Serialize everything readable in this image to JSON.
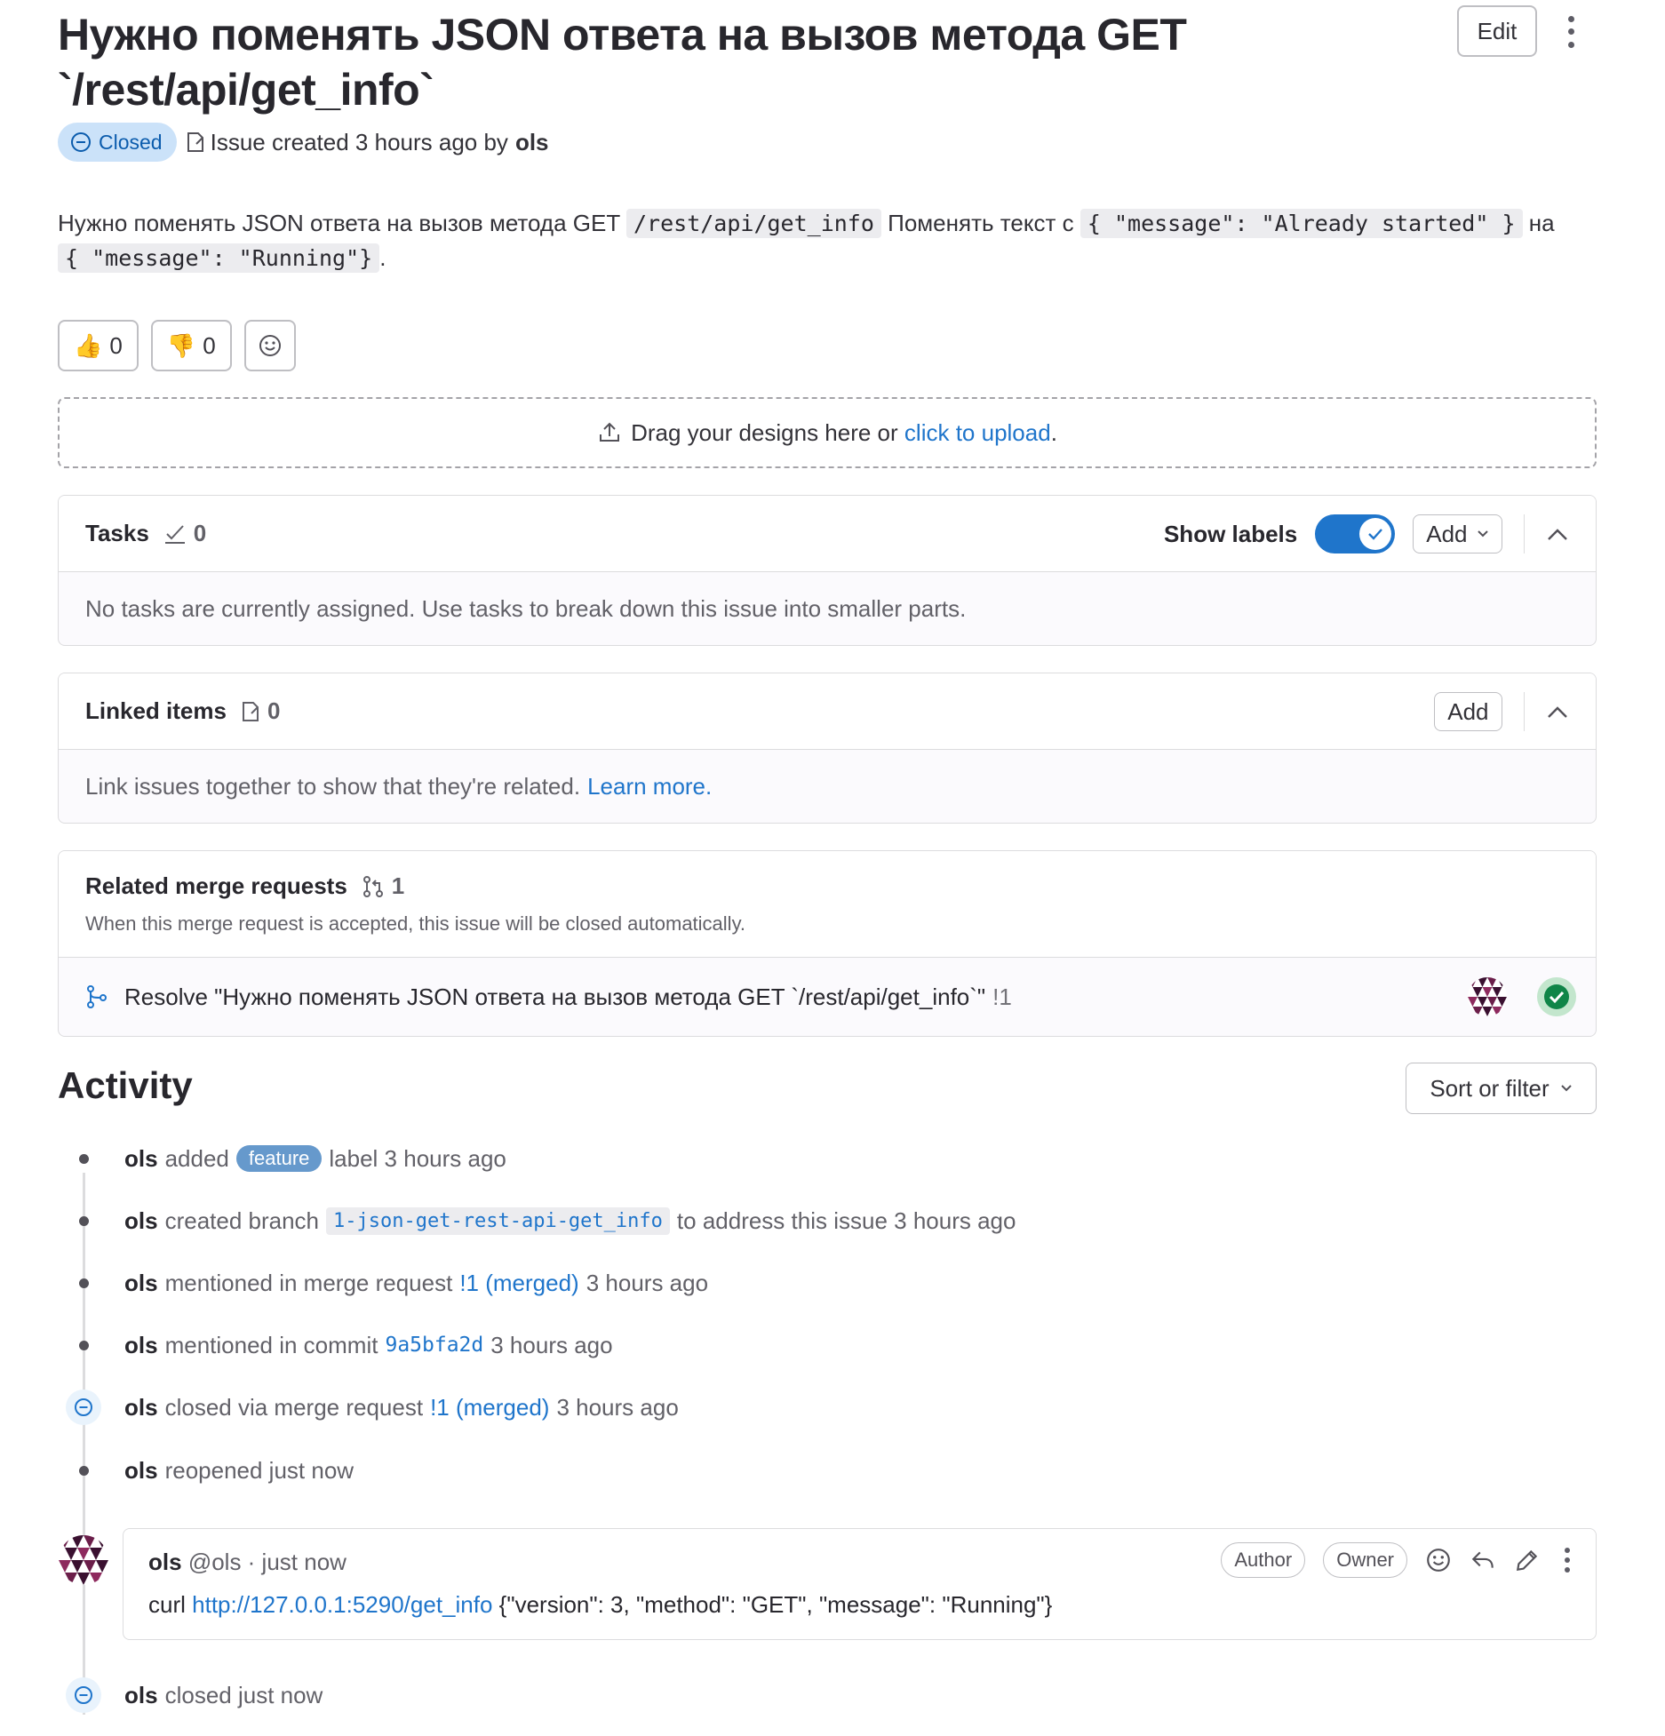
{
  "issue": {
    "title": "Нужно поменять JSON ответа на вызов метода GET `/rest/api/get_info`",
    "status": "Closed",
    "created_text": "Issue created 3 hours ago by",
    "author": "ols",
    "edit_label": "Edit"
  },
  "description": {
    "part1": "Нужно поменять JSON ответа на вызов метода GET",
    "code1": "/rest/api/get_info",
    "part2": "Поменять текст с",
    "code2": "{ \"message\": \"Already started\" }",
    "part3": "на",
    "code3": "{ \"message\": \"Running\"}",
    "part4": "."
  },
  "reactions": {
    "thumbs_up_emoji": "👍",
    "thumbs_up_count": "0",
    "thumbs_down_emoji": "👎",
    "thumbs_down_count": "0"
  },
  "designs": {
    "text": "Drag your designs here or",
    "link": "click to upload",
    "suffix": "."
  },
  "tasks": {
    "title": "Tasks",
    "count": "0",
    "show_labels": "Show labels",
    "add_label": "Add",
    "empty_text": "No tasks are currently assigned. Use tasks to break down this issue into smaller parts."
  },
  "linked": {
    "title": "Linked items",
    "count": "0",
    "add_label": "Add",
    "empty_text": "Link issues together to show that they're related.",
    "learn_more": "Learn more."
  },
  "related_mrs": {
    "title": "Related merge requests",
    "count": "1",
    "subtitle": "When this merge request is accepted, this issue will be closed automatically.",
    "items": [
      {
        "title": "Resolve \"Нужно поменять JSON ответа на вызов метода GET `/rest/api/get_info`\"",
        "iid": "!1"
      }
    ]
  },
  "activity": {
    "title": "Activity",
    "sort_label": "Sort or filter",
    "events": [
      {
        "user": "ols",
        "pre": "added",
        "badge": "feature",
        "post": "label 3 hours ago"
      },
      {
        "user": "ols",
        "pre": "created branch",
        "branch": "1-json-get-rest-api-get_info",
        "post": "to address this issue 3 hours ago"
      },
      {
        "user": "ols",
        "pre": "mentioned in merge request",
        "link": "!1 (merged)",
        "post": "3 hours ago"
      },
      {
        "user": "ols",
        "pre": "mentioned in commit",
        "commit": "9a5bfa2d",
        "post": "3 hours ago"
      },
      {
        "user": "ols",
        "pre": "closed via merge request",
        "link": "!1 (merged)",
        "post": "3 hours ago"
      },
      {
        "user": "ols",
        "pre": "reopened just now"
      },
      {
        "user": "ols",
        "pre": "closed just now"
      }
    ],
    "comment": {
      "author": "ols",
      "handle": "@ols · just now",
      "badge_author": "Author",
      "badge_owner": "Owner",
      "body_prefix": "curl",
      "body_link": "http://127.0.0.1:5290/get_info",
      "body_suffix": "{\"version\": 3, \"method\": \"GET\", \"message\": \"Running\"}"
    }
  },
  "colors": {
    "accent": "#1f75cb",
    "closed_badge_bg": "#cbe2f9",
    "feature_label": "#6699cc",
    "pipeline_success": "#108548"
  }
}
